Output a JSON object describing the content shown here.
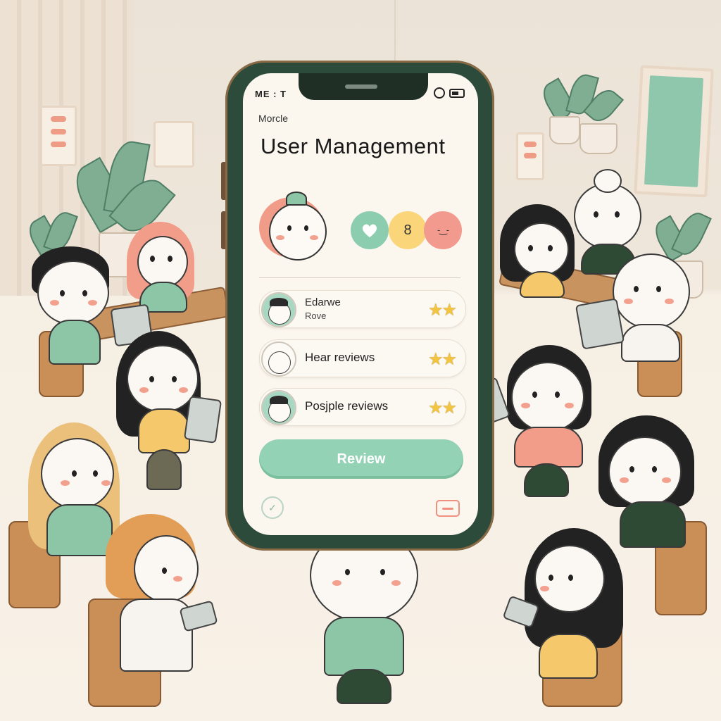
{
  "status_bar": {
    "left": "ME : T"
  },
  "app": {
    "label": "Morcle",
    "title": "User Management"
  },
  "profile": {
    "stats": [
      {
        "icon": "heart-icon",
        "value": ""
      },
      {
        "icon": "number",
        "value": "8"
      },
      {
        "icon": "face-icon",
        "value": "-‿-"
      }
    ]
  },
  "reviews": [
    {
      "name": "Edarwe",
      "sub": "Rove",
      "stars": "★★"
    },
    {
      "text": "Hear reviews",
      "stars": "★★"
    },
    {
      "text": "Posjple reviews",
      "stars": "★★"
    }
  ],
  "actions": {
    "review_label": "Review"
  },
  "colors": {
    "accent_green": "#93d2b5",
    "accent_coral": "#f19c88",
    "accent_yellow": "#fbd57a",
    "phone_frame": "#2d4b3a"
  }
}
